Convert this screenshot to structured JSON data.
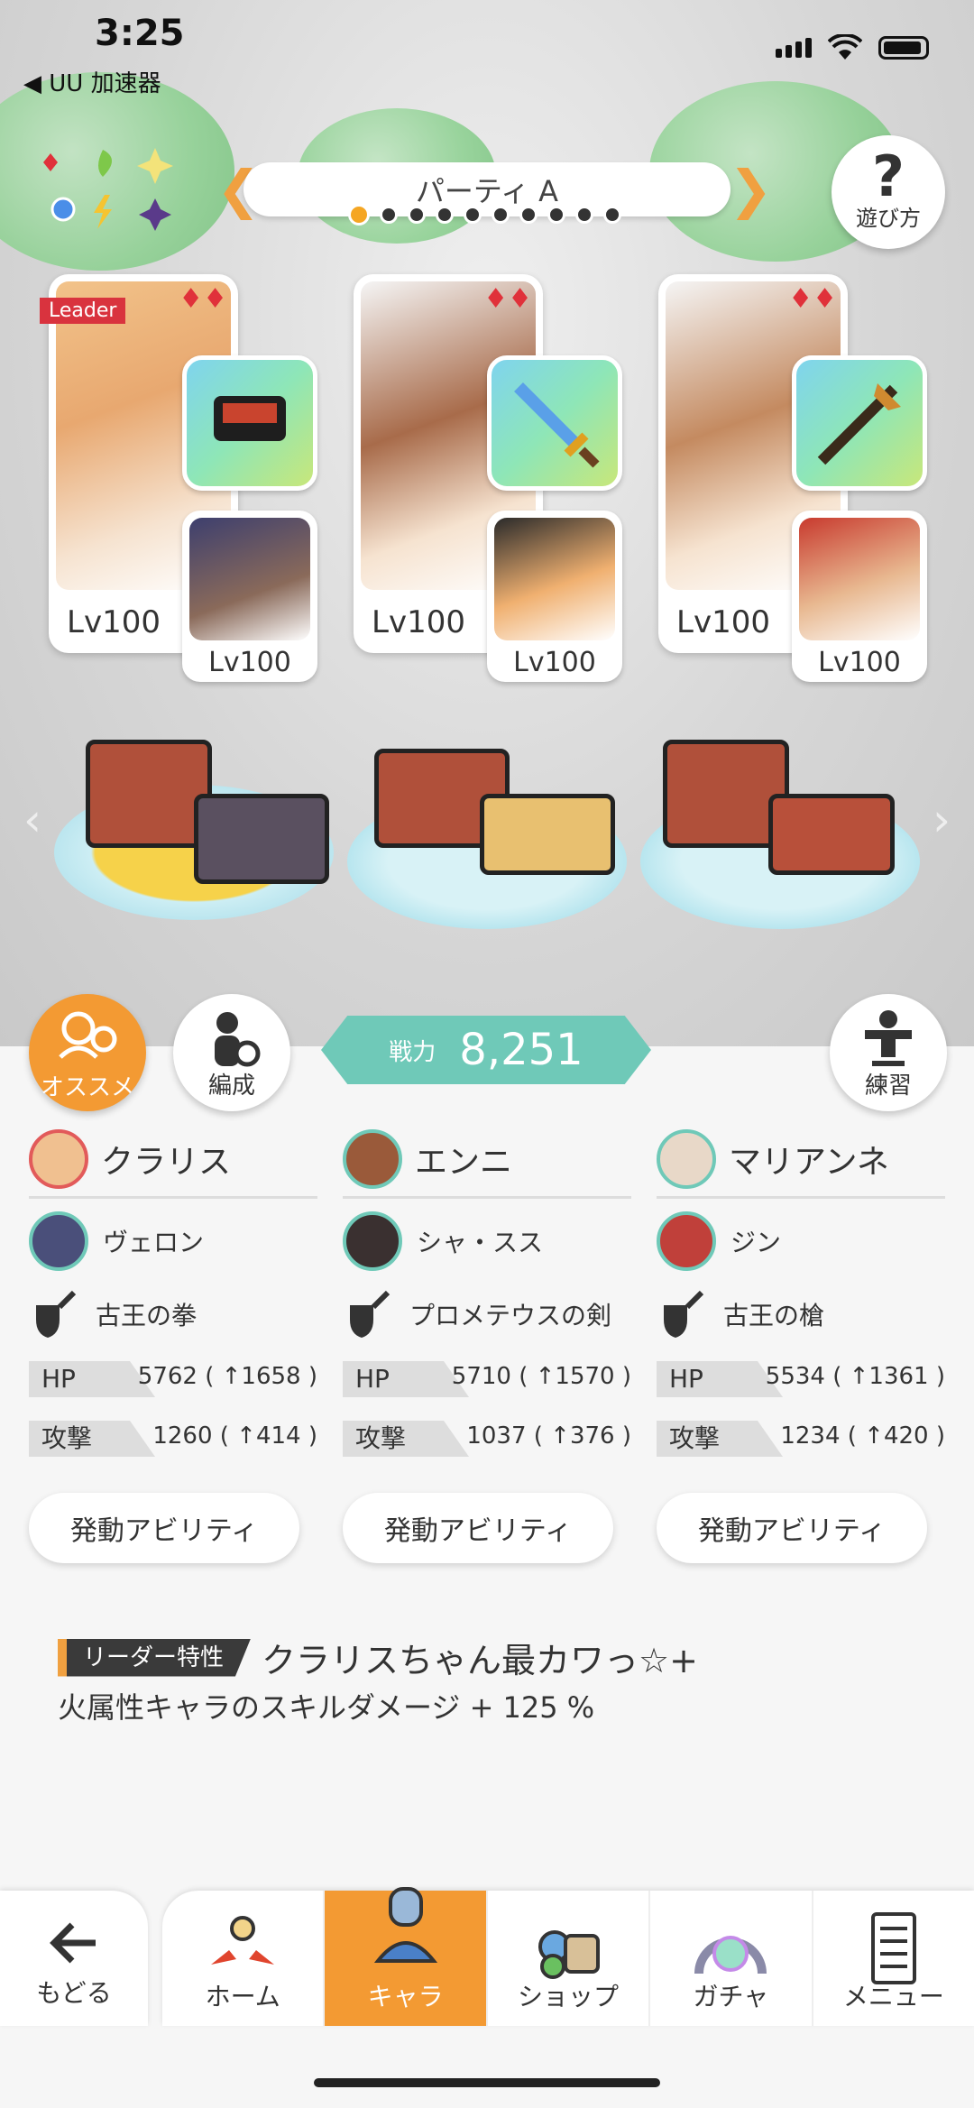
{
  "status_bar": {
    "time": "3:25",
    "back_app": "◀ UU 加速器"
  },
  "party": {
    "title": "パーティ A",
    "prev_arrow": "❮",
    "next_arrow": "❯",
    "page_count": 10,
    "active_index": 0
  },
  "help_button": {
    "label": "遊び方",
    "icon": "?"
  },
  "leader_badge": "Leader",
  "teams": [
    {
      "main_level": "Lv100",
      "sub_level": "Lv100",
      "main_suit": "♦♦"
    },
    {
      "main_level": "Lv100",
      "sub_level": "Lv100",
      "main_suit": "♦♦"
    },
    {
      "main_level": "Lv100",
      "sub_level": "Lv100",
      "main_suit": "♦♦"
    }
  ],
  "actions": {
    "recommend": "オススメ",
    "formation": "編成",
    "practice": "練習"
  },
  "power": {
    "label": "戦力",
    "value": "8,251"
  },
  "columns": [
    {
      "main": "クラリス",
      "sub": "ヴェロン",
      "weapon": "古王の拳",
      "hp_label": "HP",
      "hp": "5762 ( ↑1658 )",
      "atk_label": "攻撃",
      "atk": "1260 ( ↑414 )",
      "ability": "発動アビリティ"
    },
    {
      "main": "エンニ",
      "sub": "シャ・スス",
      "weapon": "プロメテウスの剣",
      "hp_label": "HP",
      "hp": "5710 ( ↑1570 )",
      "atk_label": "攻撃",
      "atk": "1037 ( ↑376 )",
      "ability": "発動アビリティ"
    },
    {
      "main": "マリアンネ",
      "sub": "ジン",
      "weapon": "古王の槍",
      "hp_label": "HP",
      "hp": "5534 ( ↑1361 )",
      "atk_label": "攻撃",
      "atk": "1234 ( ↑420 )",
      "ability": "発動アビリティ"
    }
  ],
  "leader_trait": {
    "tag": "リーダー特性",
    "name": "クラリスちゃん最カワっ☆+",
    "desc": "火属性キャラのスキルダメージ + 125 %"
  },
  "nav": {
    "back": "もどる",
    "tabs": [
      "ホーム",
      "キャラ",
      "ショップ",
      "ガチャ",
      "メニュー"
    ],
    "active": "キャラ"
  },
  "colors": {
    "accent": "#f39a33",
    "teal": "#6fc9b8",
    "suit_red": "#e0313a"
  }
}
